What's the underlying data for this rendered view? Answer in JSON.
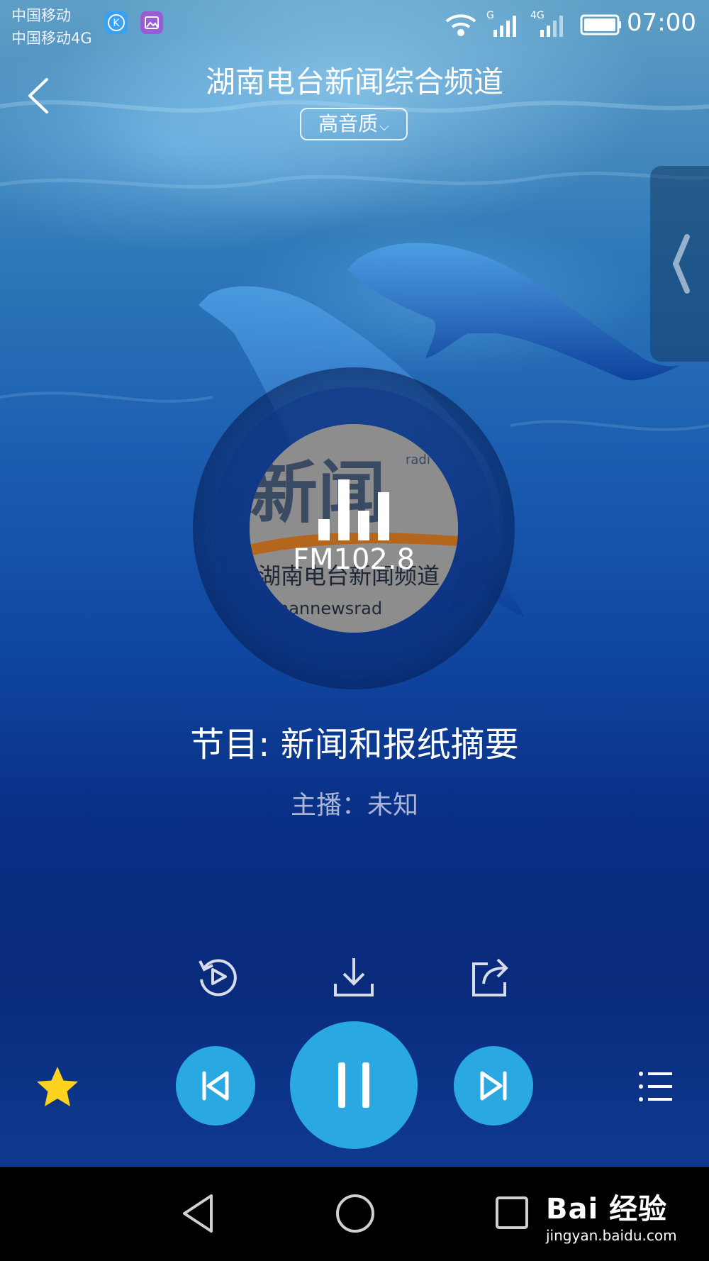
{
  "status_bar": {
    "carrier_1": "中国移动",
    "carrier_2": "中国移动4G",
    "network_labels": [
      "G",
      "4G"
    ],
    "time": "07:00",
    "app_icons": [
      "k-app-icon",
      "gallery-icon"
    ]
  },
  "header": {
    "title": "湖南电台新闻综合频道",
    "quality": "高音质"
  },
  "player": {
    "cover_text_top": "新闻",
    "cover_text_radio": "radi",
    "cover_text_sub": "湖南电台新闻频道",
    "cover_text_en": "nannewsrad",
    "frequency": "FM102.8",
    "program": "节目: 新闻和报纸摘要",
    "host": "主播：未知"
  },
  "controls": {
    "favorite_active": true,
    "state": "playing",
    "accent_color": "#2aa8e2",
    "star_color": "#ffd21f"
  },
  "watermark": {
    "brand": "Bai 经验",
    "url": "jingyan.baidu.com"
  }
}
